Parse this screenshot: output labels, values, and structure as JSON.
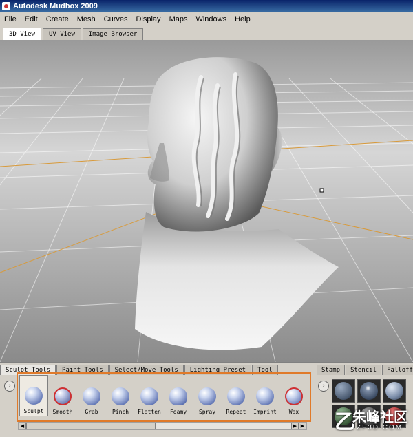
{
  "window": {
    "title": "Autodesk Mudbox 2009"
  },
  "menu": [
    "File",
    "Edit",
    "Create",
    "Mesh",
    "Curves",
    "Display",
    "Maps",
    "Windows",
    "Help"
  ],
  "view_tabs": [
    {
      "label": "3D View",
      "active": true
    },
    {
      "label": "UV View",
      "active": false
    },
    {
      "label": "Image Browser",
      "active": false
    }
  ],
  "tool_tabs": [
    {
      "label": "Sculpt Tools",
      "active": true
    },
    {
      "label": "Paint Tools",
      "active": false
    },
    {
      "label": "Select/Move Tools",
      "active": false
    },
    {
      "label": "Lighting Preset",
      "active": false
    },
    {
      "label": "Tool",
      "active": false
    }
  ],
  "sculpt_tools": [
    {
      "label": "Sculpt",
      "icon": "sculpt-icon",
      "active": true
    },
    {
      "label": "Smooth",
      "icon": "smooth-icon",
      "active": false
    },
    {
      "label": "Grab",
      "icon": "grab-icon",
      "active": false
    },
    {
      "label": "Pinch",
      "icon": "pinch-icon",
      "active": false
    },
    {
      "label": "Flatten",
      "icon": "flatten-icon",
      "active": false
    },
    {
      "label": "Foamy",
      "icon": "foamy-icon",
      "active": false
    },
    {
      "label": "Spray",
      "icon": "spray-icon",
      "active": false
    },
    {
      "label": "Repeat",
      "icon": "repeat-icon",
      "active": false
    },
    {
      "label": "Imprint",
      "icon": "imprint-icon",
      "active": false
    },
    {
      "label": "Wax",
      "icon": "wax-icon",
      "active": false
    }
  ],
  "stamp_tabs": [
    {
      "label": "Stamp"
    },
    {
      "label": "Stencil"
    },
    {
      "label": "Falloff"
    }
  ],
  "swatches": [
    "#4a5a70",
    "#3c4c64",
    "#7a8ca8",
    "#3a5a3a",
    "#4a4a4a",
    "#a02020"
  ],
  "colors": {
    "accent_highlight": "#e07a2a",
    "title_bar": "#0a246a",
    "grid_axis": "#d89a3a"
  },
  "watermark": {
    "cn": "朱峰社区",
    "url": "ZF3D.COM"
  }
}
